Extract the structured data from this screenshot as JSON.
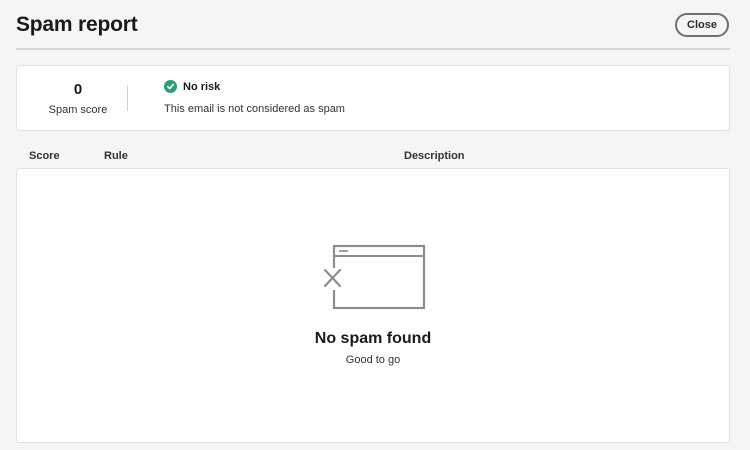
{
  "dialog": {
    "title": "Spam report",
    "close_label": "Close"
  },
  "summary": {
    "score_value": "0",
    "score_label": "Spam score",
    "status_icon": "check-circle-icon",
    "status_color": "#2d9d78",
    "status": "No risk",
    "description": "This email is not considered as spam"
  },
  "table": {
    "columns": [
      "Score",
      "Rule",
      "Description"
    ],
    "rows": []
  },
  "empty_state": {
    "icon": "empty-window-icon",
    "title": "No spam found",
    "subtitle": "Good to go"
  }
}
